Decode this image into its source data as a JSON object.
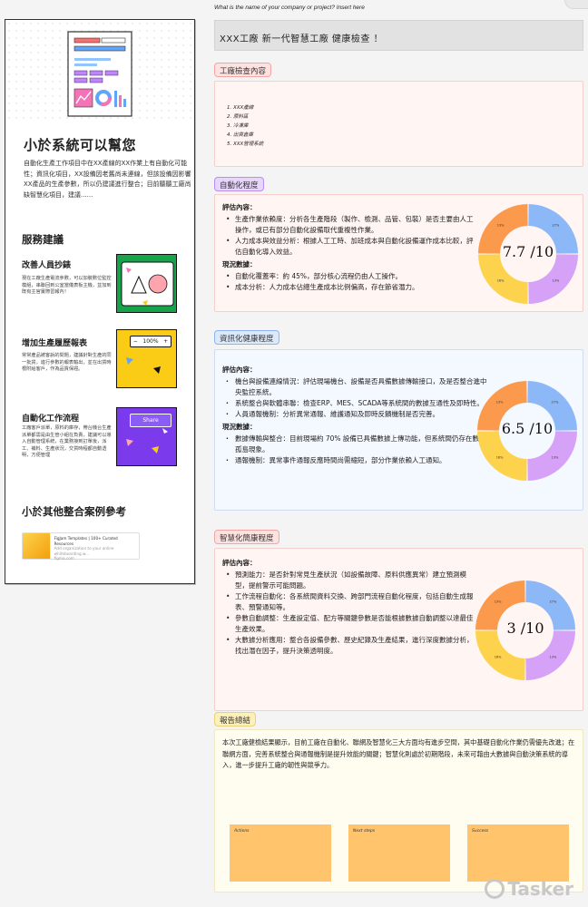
{
  "top_question": "What is the name of your company or project? Insert here",
  "left": {
    "title": "小於系統可以幫您",
    "intro": "自動化生產工作項目中在XX產線的XX作業上有自動化可能性；資訊化項目，XX設備因老舊尚未連線，但該設備因影響XX產品的生產參數，所以仍建議進行整合；目前聽聽工廠尚缺智慧化項目，建議......",
    "services_title": "服務建議",
    "services": [
      {
        "title": "改善人員抄錶",
        "desc": "現在工廠生產電流參數，可以加裝數位監控模組，串聯回到公室當儀表板主機，並加到既有主官實際習報內！",
        "img_label": ""
      },
      {
        "title": "增加生產履歷報表",
        "desc": "常常產品被客訴的問題，建議針對生產的同一批貨，進行參數的報表輸出，並在出貨時根附給客戶，作為品質保證。",
        "img_label": "100%"
      },
      {
        "title": "自動化工作流程",
        "desc": "工廠客戶派單，原料的庫存，帶台機台生產派單都需是由生管小組在負責，建議可以導入自動管理系統，在業務接到訂單後，派工、補料、生產狀況，交貨時程都自動透明，方便管理",
        "img_label": "Share"
      }
    ],
    "cases_title": "小於其他整合案例參考",
    "case_card": {
      "title": "FigJam Templates | 100+ Curated Resources",
      "subtitle": "Add organization to your online whiteboarding w...",
      "source": "figma.com"
    }
  },
  "header_title": "XXX工廠 新一代智慧工廠 健康檢查 ！",
  "inspection": {
    "label": "工廠檢查內容",
    "items": [
      "1. XXX產線",
      "2. 原料區",
      "3. 冷凍庫",
      "4. 出貨倉庫",
      "5. XXX管理系統"
    ]
  },
  "automation": {
    "label": "自動化程度",
    "eval_title": "評估內容：",
    "eval_items": [
      "生產作業依賴度：分析各生產階段（製作、檢測、品管、包裝）是否主要由人工操作，或已有部分自動化設備取代重複性作業。",
      "人力成本與效益分析：根據人工工時、加班成本與自動化設備運作成本比較，評估自動化導入效益。"
    ],
    "data_title": "現況數據：",
    "data_items": [
      "自動化覆蓋率：約 45%，部分核心流程仍由人工操作。",
      "成本分析：人力成本佔總生產成本比例偏高，存在節省潛力。"
    ],
    "score": "7.7 /10",
    "donut_labels": [
      "27%",
      "13%",
      "16%",
      "13%"
    ]
  },
  "it_health": {
    "label": "資訊化健康程度",
    "eval_title": "評估內容：",
    "eval_items": [
      "機台與設備連線情況：評估現場機台、設備是否具備數據傳輸接口，及是否整合進中央監控系統。",
      "系統整合與軟體串聯：檢查ERP、MES、SCADA等系統間的數據互通性及即時性。",
      "人員通報機制：分析異常通報、維護通知及即時反饋機制是否完善。"
    ],
    "data_title": "現況數據：",
    "data_items": [
      "數據傳輸與整合：目前現場約 70% 設備已具備數據上傳功能，但系統間仍存在數據孤島現象。",
      "通報機制：異常事件通報反應時間尚需縮短，部分作業依賴人工通知。"
    ],
    "score": "6.5 /10",
    "donut_labels": [
      "27%",
      "13%",
      "16%",
      "13%"
    ]
  },
  "intelligence": {
    "label": "智慧化簡康程度",
    "eval_title": "評估內容：",
    "eval_items": [
      "預測能力：是否針對常見生產狀況（如設備故障、原料供應異常）建立預測模型，提前警示可能問題。",
      "工作流程自動化：各系統間資料交換、跨部門流程自動化程度，包括自動生成報表、預警通知等。",
      "參數自動調整：生產設定值、配方等關鍵參數是否能根據數據自動調整以達最佳生產效果。",
      "大數據分析應用：整合各設備參數、歷史紀錄及生產結果，進行深度數據分析，找出潛在因子，提升決策透明度。"
    ],
    "score": "3 /10",
    "donut_labels": [
      "27%",
      "13%",
      "16%",
      "13%"
    ]
  },
  "summary": {
    "label": "報告總結",
    "text": "本次工廠健檢結果顯示，目前工廠在自動化、聯網及智慧化三大方面均有進步空間，其中基礎自動化作業仍需優先改進；在聯網方面，完善系統整合與通報機制是提升效能的關鍵；智慧化則處於初期階段，未來可藉由大數據與自動決策系統的導入，進一步提升工廠的韌性與競爭力。",
    "stickies": [
      "Actions",
      "Next steps",
      "Success"
    ]
  },
  "watermark": "Tasker",
  "colors": {
    "donut_blue": "#8db8f8",
    "donut_purple": "#d5a2f7",
    "donut_yellow": "#fdd34d",
    "donut_orange": "#fb9a4c"
  }
}
